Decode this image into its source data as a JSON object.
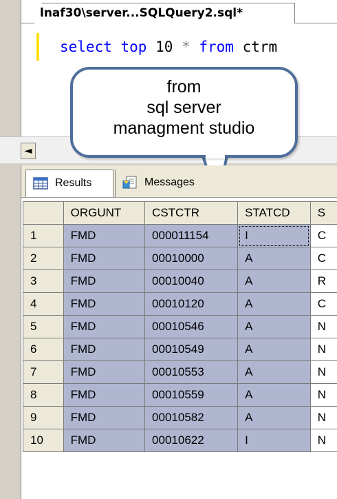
{
  "editor": {
    "tab_title": "lnaf30\\server...SQLQuery2.sql*",
    "code": {
      "kw1": "select",
      "kw2": "top",
      "num": "10",
      "star": "*",
      "kw3": "from",
      "tail": "ctrm"
    }
  },
  "callout": {
    "line1": "from",
    "line2": "sql server",
    "line3": "managment studio"
  },
  "scrollbar": {
    "left_arrow": "◄"
  },
  "results_tabs": [
    {
      "label": "Results",
      "icon": "grid-icon"
    },
    {
      "label": "Messages",
      "icon": "messages-icon"
    }
  ],
  "grid": {
    "columns": [
      "",
      "ORGUNT",
      "CSTCTR",
      "STATCD",
      "S"
    ],
    "rows": [
      [
        "1",
        "FMD",
        "000011154",
        "I",
        "C"
      ],
      [
        "2",
        "FMD",
        "00010000",
        "A",
        "C"
      ],
      [
        "3",
        "FMD",
        "00010040",
        "A",
        "R"
      ],
      [
        "4",
        "FMD",
        "00010120",
        "A",
        "C"
      ],
      [
        "5",
        "FMD",
        "00010546",
        "A",
        "N"
      ],
      [
        "6",
        "FMD",
        "00010549",
        "A",
        "N"
      ],
      [
        "7",
        "FMD",
        "00010553",
        "A",
        "N"
      ],
      [
        "8",
        "FMD",
        "00010559",
        "A",
        "N"
      ],
      [
        "9",
        "FMD",
        "00010582",
        "A",
        "N"
      ],
      [
        "10",
        "FMD",
        "00010622",
        "I",
        "N"
      ]
    ]
  },
  "colors": {
    "selection": "#b0b5d0",
    "callout_border": "#4f6e9c",
    "keyword": "#0000ff",
    "current_line_marker": "#ffe000"
  }
}
